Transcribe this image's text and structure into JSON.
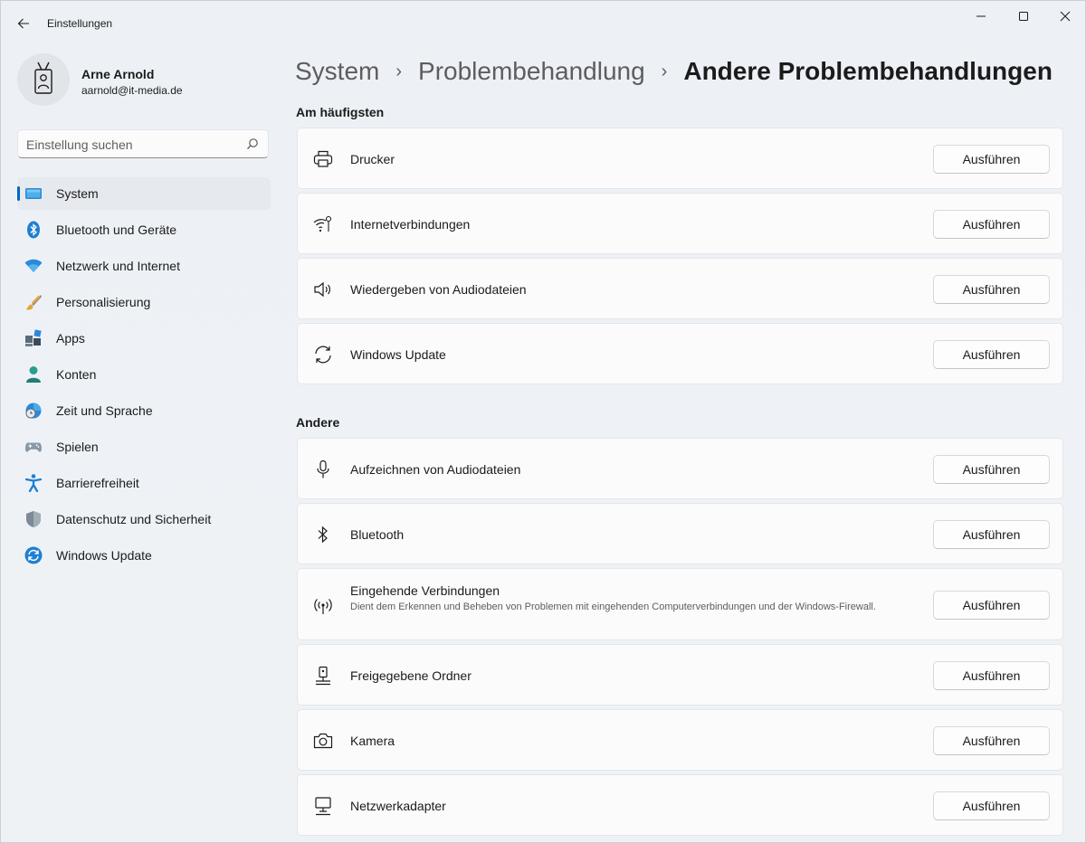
{
  "window": {
    "title": "Einstellungen"
  },
  "profile": {
    "name": "Arne Arnold",
    "email": "aarnold@it-media.de"
  },
  "search": {
    "placeholder": "Einstellung suchen"
  },
  "sidebar": {
    "items": [
      {
        "label": "System",
        "icon": "system-icon",
        "active": true
      },
      {
        "label": "Bluetooth und Geräte",
        "icon": "bluetooth-icon"
      },
      {
        "label": "Netzwerk und Internet",
        "icon": "wifi-icon"
      },
      {
        "label": "Personalisierung",
        "icon": "brush-icon"
      },
      {
        "label": "Apps",
        "icon": "apps-icon"
      },
      {
        "label": "Konten",
        "icon": "account-icon"
      },
      {
        "label": "Zeit und Sprache",
        "icon": "time-language-icon"
      },
      {
        "label": "Spielen",
        "icon": "gamepad-icon"
      },
      {
        "label": "Barrierefreiheit",
        "icon": "accessibility-icon"
      },
      {
        "label": "Datenschutz und Sicherheit",
        "icon": "shield-icon"
      },
      {
        "label": "Windows Update",
        "icon": "windows-update-icon"
      }
    ]
  },
  "breadcrumb": {
    "level1": "System",
    "level2": "Problembehandlung",
    "current": "Andere Problembehandlungen",
    "separator": "›"
  },
  "sections": {
    "frequent": {
      "title": "Am häufigsten",
      "items": [
        {
          "title": "Drucker",
          "icon": "printer-icon",
          "button": "Ausführen"
        },
        {
          "title": "Internetverbindungen",
          "icon": "internet-connection-icon",
          "button": "Ausführen"
        },
        {
          "title": "Wiedergeben von Audiodateien",
          "icon": "speaker-icon",
          "button": "Ausführen"
        },
        {
          "title": "Windows Update",
          "icon": "refresh-icon",
          "button": "Ausführen"
        }
      ]
    },
    "other": {
      "title": "Andere",
      "items": [
        {
          "title": "Aufzeichnen von Audiodateien",
          "icon": "microphone-icon",
          "button": "Ausführen"
        },
        {
          "title": "Bluetooth",
          "icon": "bluetooth-icon",
          "button": "Ausführen"
        },
        {
          "title": "Eingehende Verbindungen",
          "description": "Dient dem Erkennen und Beheben von Problemen mit eingehenden Computerverbindungen und der Windows-Firewall.",
          "icon": "incoming-connection-icon",
          "button": "Ausführen"
        },
        {
          "title": "Freigegebene Ordner",
          "icon": "shared-folder-icon",
          "button": "Ausführen"
        },
        {
          "title": "Kamera",
          "icon": "camera-icon",
          "button": "Ausführen"
        },
        {
          "title": "Netzwerkadapter",
          "icon": "network-adapter-icon",
          "button": "Ausführen"
        }
      ]
    }
  },
  "colors": {
    "accent": "#0067c0",
    "background": "#eef2f6",
    "card": "#fbfbfc"
  }
}
